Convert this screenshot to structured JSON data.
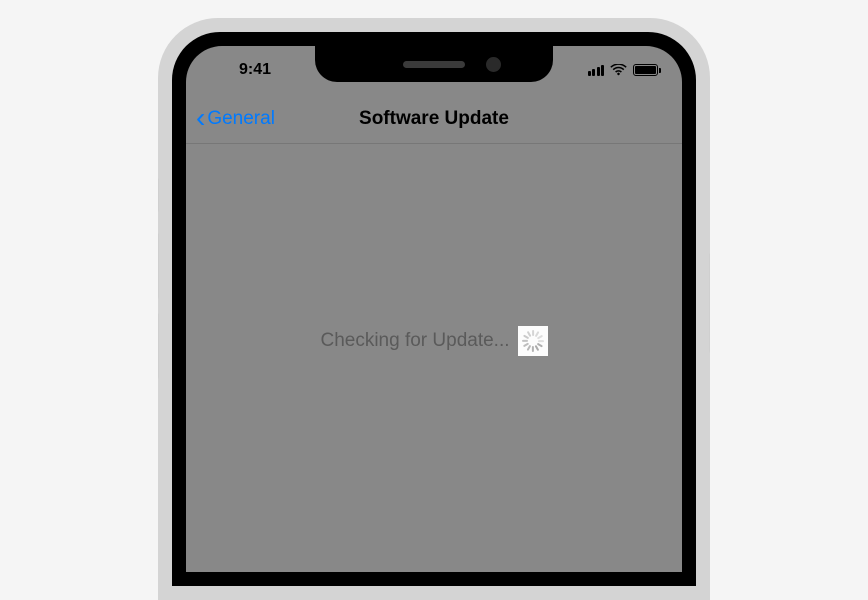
{
  "status_bar": {
    "time": "9:41"
  },
  "nav": {
    "back_label": "General",
    "title": "Software Update"
  },
  "content": {
    "status_text": "Checking for Update..."
  }
}
